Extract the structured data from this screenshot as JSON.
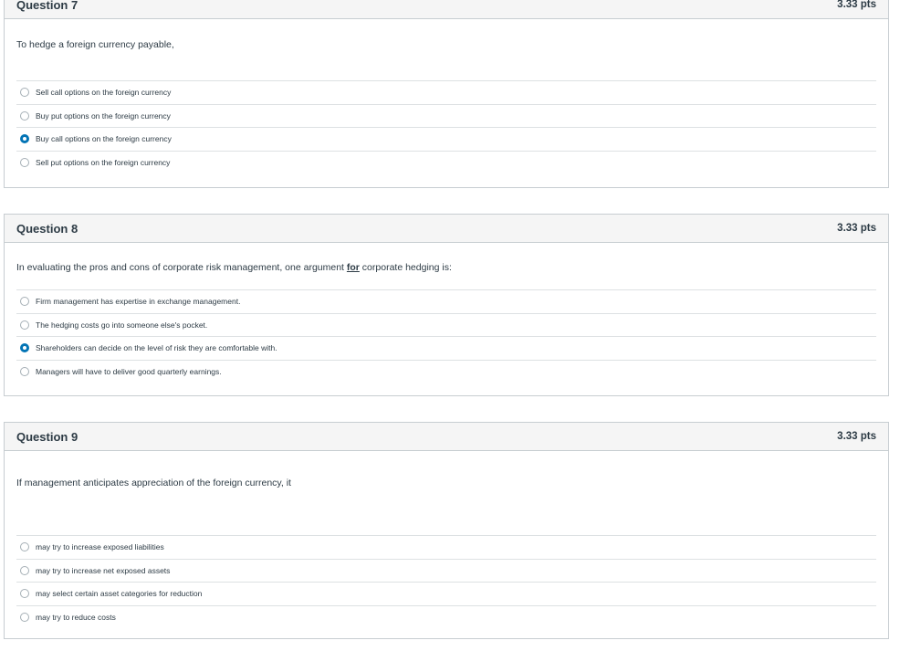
{
  "questions": [
    {
      "title": "Question 7",
      "points": "3.33 pts",
      "prompt": "To hedge a foreign currency payable,",
      "answers": [
        {
          "label": "Sell call options on the foreign currency",
          "selected": false
        },
        {
          "label": "Buy put options on the foreign currency",
          "selected": false
        },
        {
          "label": "Buy call options on the foreign currency",
          "selected": true
        },
        {
          "label": "Sell put options on the foreign currency",
          "selected": false
        }
      ]
    },
    {
      "title": "Question 8",
      "points": "3.33 pts",
      "prompt_before": "In evaluating the pros and cons of corporate risk management, one argument ",
      "prompt_emphasis": "for",
      "prompt_after": " corporate hedging is:",
      "answers": [
        {
          "label": "Firm management has expertise in exchange management.",
          "selected": false
        },
        {
          "label": "The hedging costs go into someone else's pocket.",
          "selected": false
        },
        {
          "label": "Shareholders can decide on the level of risk they are comfortable with.",
          "selected": true
        },
        {
          "label": "Managers will have to deliver good quarterly earnings.",
          "selected": false
        }
      ]
    },
    {
      "title": "Question 9",
      "points": "3.33 pts",
      "prompt": "If management anticipates appreciation of the foreign currency, it",
      "answers": [
        {
          "label": "may try to increase exposed liabilities",
          "selected": false
        },
        {
          "label": "may try to increase net exposed assets",
          "selected": false
        },
        {
          "label": "may select certain asset categories for reduction",
          "selected": false
        },
        {
          "label": "may try to reduce costs",
          "selected": false
        }
      ]
    }
  ],
  "colors": {
    "accent": "#0374b5",
    "border": "#c7cdd1",
    "header_bg": "#f5f5f5",
    "text": "#2d3b45"
  }
}
